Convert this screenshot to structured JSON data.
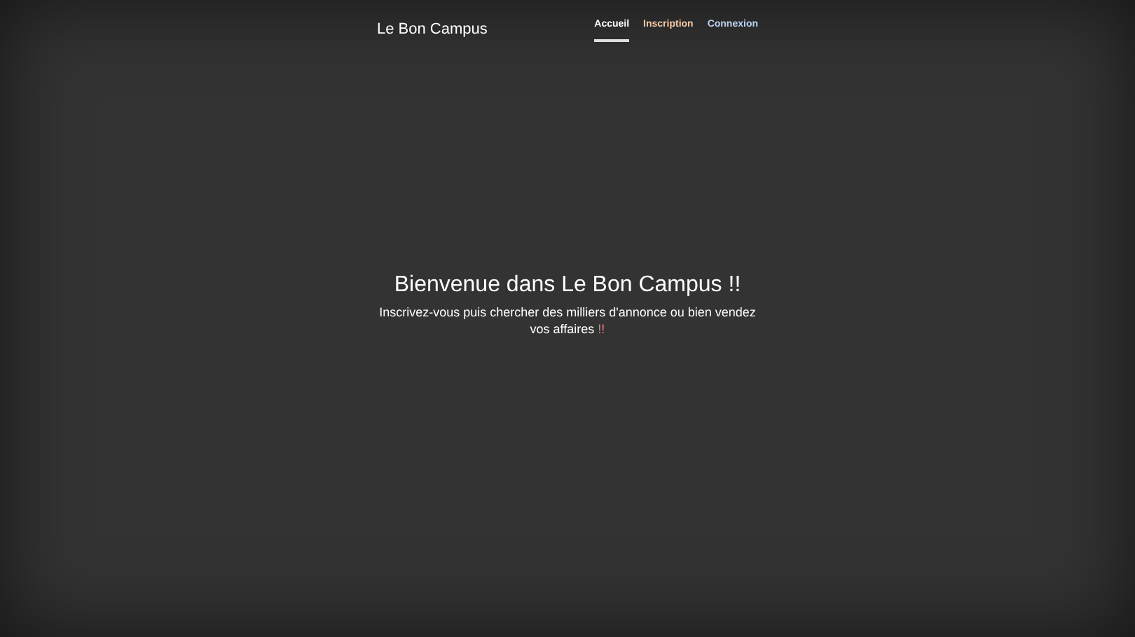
{
  "brand": "Le Bon Campus",
  "nav": [
    {
      "label": "Accueil",
      "selected": true,
      "color": "#ffffff"
    },
    {
      "label": "Inscription",
      "selected": false,
      "color": "#f2c9a8"
    },
    {
      "label": "Connexion",
      "selected": false,
      "color": "#b9d3f0"
    }
  ],
  "hero": {
    "title": "Bienvenue dans Le Bon Campus !!",
    "subtitle": "Inscrivez-vous puis chercher des milliers d'annonce ou bien vendez vos affaires",
    "subtitle_mark": "!!"
  }
}
